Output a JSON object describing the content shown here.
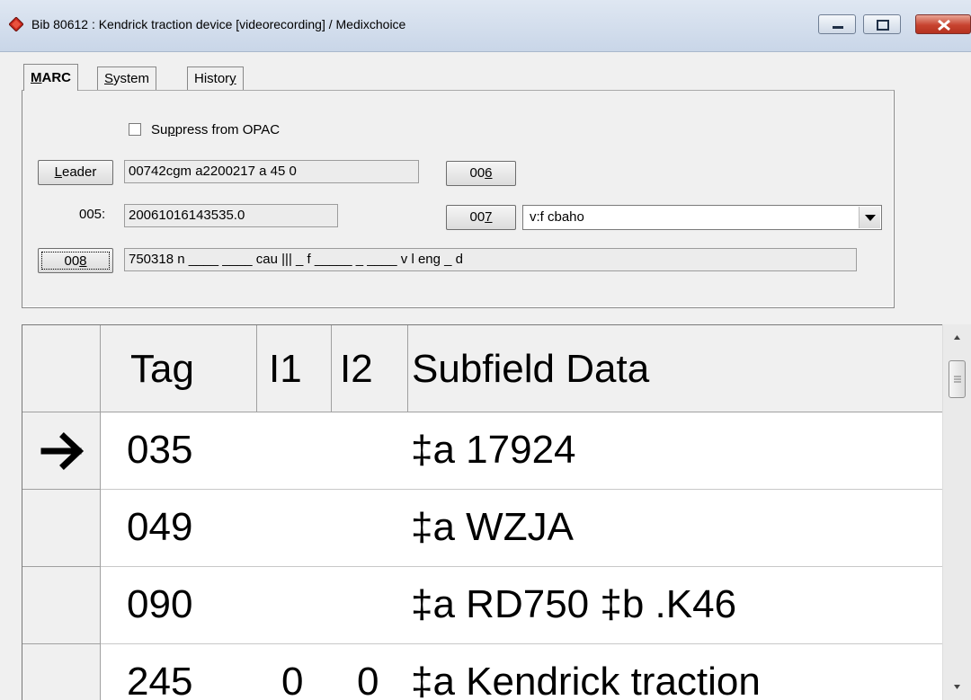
{
  "window": {
    "title": "Bib 80612 : Kendrick traction device [videorecording] / Medixchoice",
    "app_icon": "red-diamond-icon",
    "accent_color": "#c7432f"
  },
  "tabs": [
    {
      "label_ul": "M",
      "label_rest": "ARC",
      "active": true
    },
    {
      "label_ul": "S",
      "label_rest": "ystem",
      "active": false
    },
    {
      "label_pre": "Histor",
      "label_ul": "y",
      "active": false
    }
  ],
  "suppress": {
    "label_pre": "Su",
    "label_ul": "p",
    "label_rest": "press from OPAC",
    "checked": false
  },
  "leader": {
    "button_ul": "L",
    "button_rest": "eader",
    "value": "00742cgm a2200217 a 45  0"
  },
  "field005": {
    "label": "005:",
    "value": "20061016143535.0"
  },
  "field006": {
    "button_pre": "00",
    "button_ul": "6"
  },
  "field007": {
    "button_pre": "00",
    "button_ul": "7",
    "selected": "v:f cbaho"
  },
  "field008": {
    "button_pre": "00",
    "button_ul": "8",
    "value": "750318 n ____ ____ cau ||| _ f _____ _ ____ v l eng _ d"
  },
  "grid": {
    "headers": {
      "tag": "Tag",
      "i1": "I1",
      "i2": "I2",
      "data": "Subfield Data"
    },
    "current_row_icon": "arrow-right-icon",
    "rows": [
      {
        "tag": "035",
        "i1": "",
        "i2": "",
        "data": "‡a 17924"
      },
      {
        "tag": "049",
        "i1": "",
        "i2": "",
        "data": "‡a WZJA"
      },
      {
        "tag": "090",
        "i1": "",
        "i2": "",
        "data": "‡a RD750 ‡b .K46"
      },
      {
        "tag": "245",
        "i1": "0",
        "i2": "0",
        "data": "‡a Kendrick traction"
      }
    ]
  }
}
